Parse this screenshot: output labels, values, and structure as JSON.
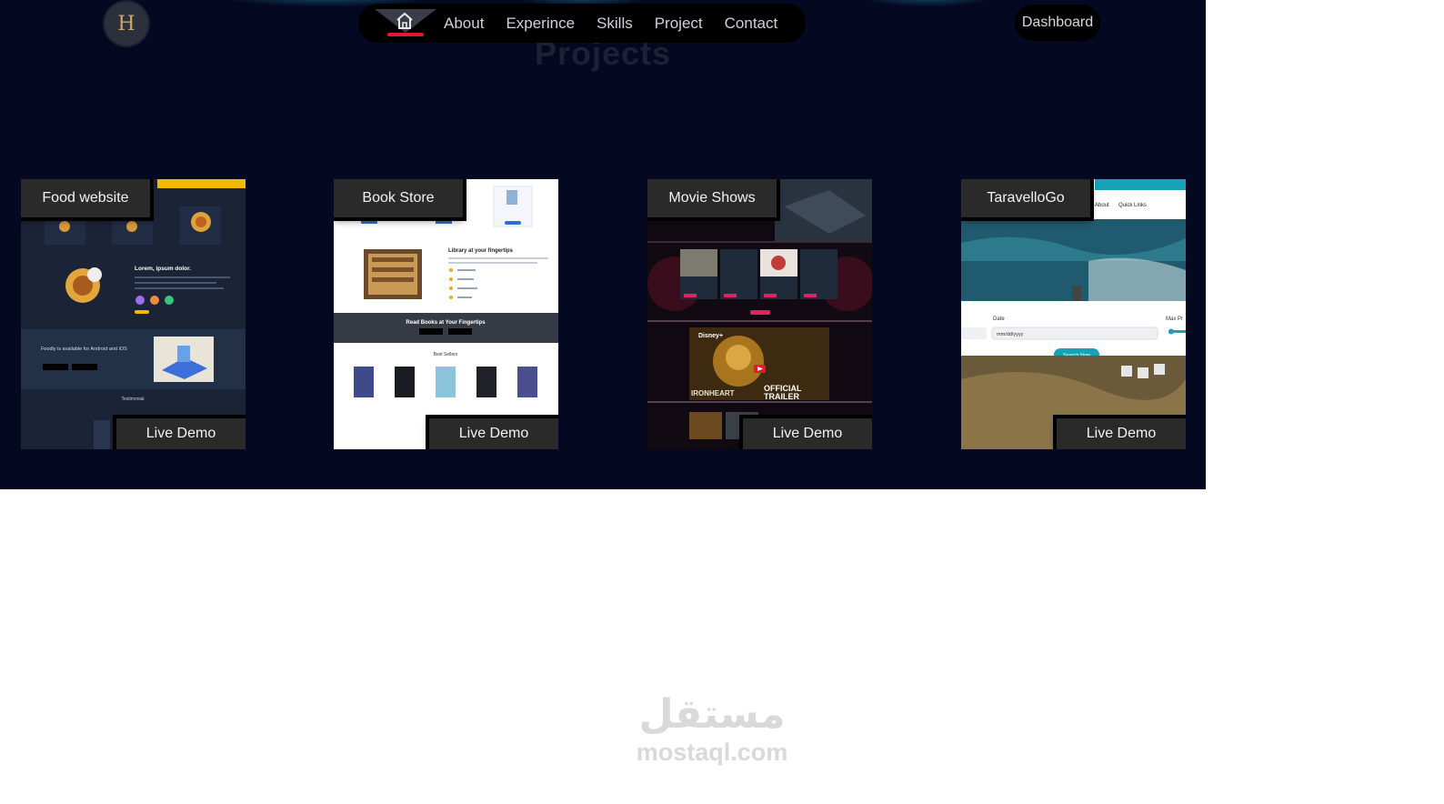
{
  "nav": {
    "logo_letter": "H",
    "home_icon": "home-icon",
    "links": [
      "About",
      "Experince",
      "Skills",
      "Project",
      "Contact"
    ],
    "dashboard_label": "Dashboard"
  },
  "section": {
    "title": "Projects"
  },
  "projects": [
    {
      "title": "Food website",
      "demo_label": "Live Demo"
    },
    {
      "title": "Book Store",
      "demo_label": "Live Demo"
    },
    {
      "title": "Movie Shows",
      "demo_label": "Live Demo"
    },
    {
      "title": "TaravelloGo",
      "demo_label": "Live Demo"
    }
  ],
  "food_shot": {
    "headline": "Lorem, ipsum dolor.",
    "app_text": "Foodly is available for Android and iOS",
    "footer_label": "Testimonial"
  },
  "book_shot": {
    "headline": "Library at your fingertips",
    "banner": "Read Books at Your Fingertips",
    "section_label": "Best Sellers"
  },
  "movie_shot": {
    "brand": "Disney+",
    "poster_title": "IRONHEART",
    "trailer_line1": "OFFICIAL",
    "trailer_line2": "TRAILER"
  },
  "travel_shot": {
    "nav_about": "About",
    "nav_links": "Quick Links",
    "date_label": "Date",
    "date_placeholder": "mm/dd/yyyy",
    "price_label": "Max Pr",
    "search_label": "Search Now"
  },
  "watermark": {
    "arabic": "مستقل",
    "latin": "mostaql.com"
  },
  "colors": {
    "page_bg": "#050821",
    "nav_bg": "#000000",
    "home_underline": "#e01b2b",
    "food_accent": "#f5b800",
    "travel_accent": "#17a2b8"
  }
}
